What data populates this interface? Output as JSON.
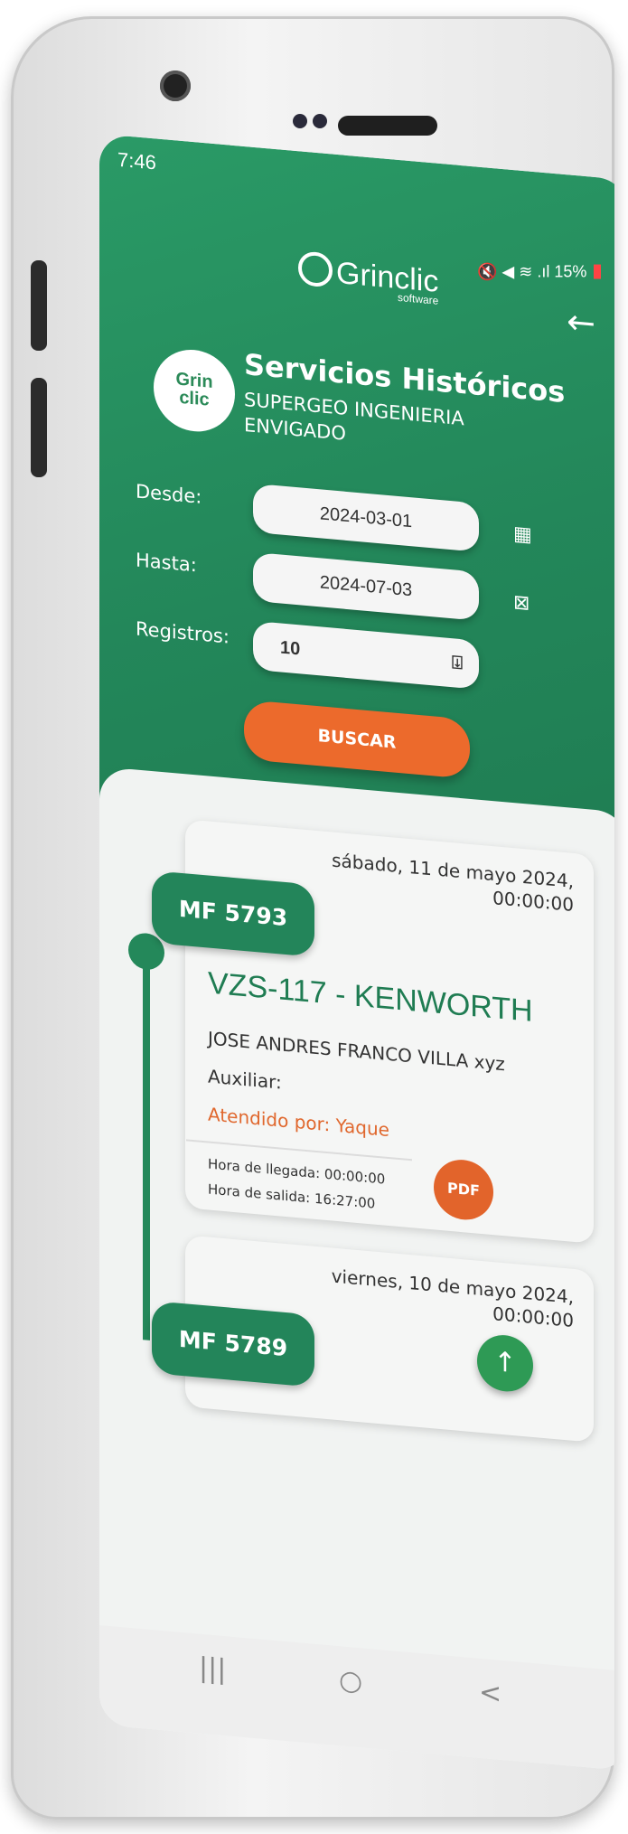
{
  "status_bar": {
    "time": "7:46",
    "icons": "🔇 ◀ ≋ .ıl",
    "battery": "15%"
  },
  "app": {
    "brand_name": "Grinclic",
    "brand_sub": "software"
  },
  "header": {
    "logo_text_1": "Grin",
    "logo_text_2": "clic",
    "title": "Servicios Históricos",
    "company_line1": "SUPERGEO INGENIERIA",
    "company_line2": "ENVIGADO",
    "back_icon": "←"
  },
  "form": {
    "desde_label": "Desde:",
    "desde_value": "2024-03-01",
    "hasta_label": "Hasta:",
    "hasta_value": "2024-07-03",
    "registros_label": "Registros:",
    "registros_value": "10",
    "buscar_label": "BUSCAR"
  },
  "records": [
    {
      "date_line1": "sábado, 11 de mayo 2024,",
      "date_line2": "00:00:00",
      "mf": "MF 5793",
      "plate": "VZS-117 - KENWORTH",
      "person": "JOSE ANDRES FRANCO VILLA xyz",
      "auxiliar": "Auxiliar:",
      "atendido": "Atendido por: Yaque",
      "hora_llegada": "Hora de llegada: 00:00:00",
      "hora_salida": "Hora de salida: 16:27:00"
    },
    {
      "date_line1": "viernes, 10 de mayo 2024,",
      "date_line2": "00:00:00",
      "mf": "MF 5789"
    }
  ],
  "nav": {
    "recent": "|||",
    "home": "○",
    "back": "<"
  },
  "colors": {
    "primary_green": "#24885a",
    "accent_orange": "#ec6a2c"
  }
}
